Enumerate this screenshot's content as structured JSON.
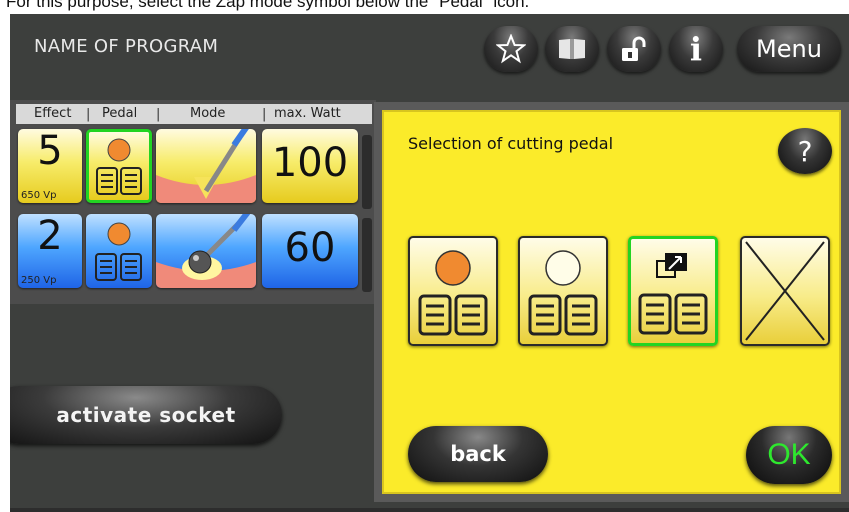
{
  "caption": "For this purpose, select the Zap mode symbol below the \"Pedal\" icon.",
  "header": {
    "title": "NAME OF PROGRAM",
    "menu_label": "Menu",
    "info_glyph": "i",
    "icons": [
      "star-icon",
      "book-icon",
      "unlock-icon",
      "info-icon"
    ]
  },
  "table": {
    "headers": [
      "Effect",
      "Pedal",
      "Mode",
      "max. Watt"
    ],
    "separator": "|",
    "rows": [
      {
        "effect": "5",
        "voltage": "650 Vp",
        "pedal": "orange",
        "mode": "cut-blade",
        "watt": "100",
        "color": "yellow"
      },
      {
        "effect": "2",
        "voltage": "250 Vp",
        "pedal": "orange",
        "mode": "coag-ball",
        "watt": "60",
        "color": "blue"
      }
    ]
  },
  "activate_socket_label": "activate socket",
  "dialog": {
    "title": "Selection of cutting pedal",
    "help_glyph": "?",
    "options": [
      {
        "name": "orange-pedal",
        "selected": false
      },
      {
        "name": "white-pedal",
        "selected": false
      },
      {
        "name": "zap-mode",
        "selected": true
      },
      {
        "name": "no-pedal",
        "selected": false
      }
    ],
    "back_label": "back",
    "ok_label": "OK"
  },
  "colors": {
    "dialog_bg": "#fbeb2a",
    "selection_green": "#22d422",
    "ok_green": "#2ee82e",
    "screen_bg": "#3d3f3d"
  }
}
